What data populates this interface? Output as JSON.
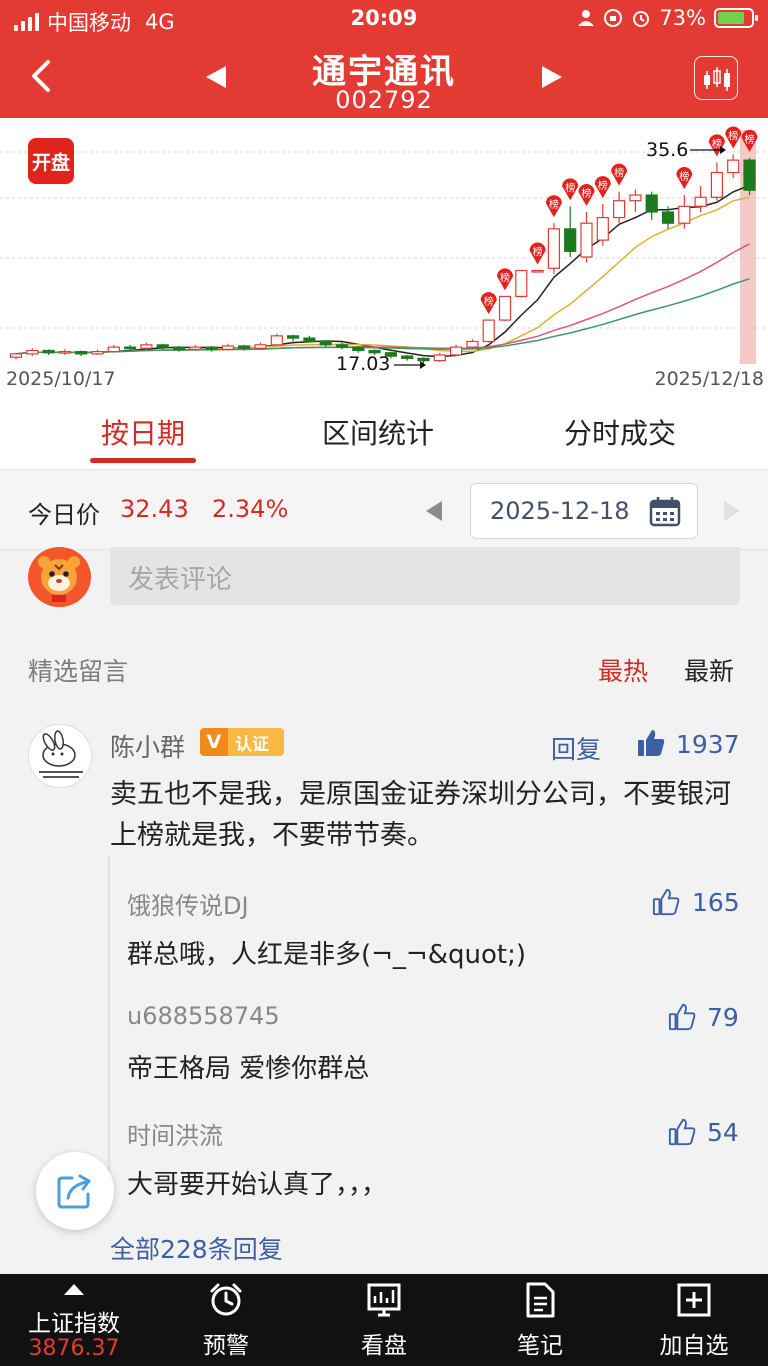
{
  "status_bar": {
    "carrier": "中国移动",
    "network": "4G",
    "time": "20:09",
    "battery": "73%"
  },
  "header": {
    "stock_name": "通宇通讯",
    "stock_code": "002792"
  },
  "chart": {
    "badge": "开盘",
    "start_date": "2025/10/17",
    "end_date": "2025/12/18",
    "high_label": "35.6",
    "low_label": "17.03",
    "list_marker": "榜",
    "colors": {
      "up": "#e33b33",
      "down": "#1d7a1d",
      "ma5": "#222222",
      "ma10": "#e0b030",
      "ma20": "#d9577a",
      "ma30": "#3a9a6a"
    }
  },
  "chart_data": {
    "type": "candlestick",
    "x_start": "2025/10/17",
    "x_end": "2025/12/18",
    "annotations": [
      {
        "label": "35.6",
        "kind": "high"
      },
      {
        "label": "17.03",
        "kind": "low"
      }
    ],
    "candles": [
      [
        17.6,
        17.9,
        17.4,
        18.0
      ],
      [
        17.9,
        18.2,
        17.7,
        18.4
      ],
      [
        18.2,
        18.0,
        17.8,
        18.3
      ],
      [
        18.0,
        18.1,
        17.8,
        18.3
      ],
      [
        18.1,
        17.9,
        17.7,
        18.2
      ],
      [
        17.9,
        18.1,
        17.8,
        18.3
      ],
      [
        18.1,
        18.5,
        18.0,
        18.7
      ],
      [
        18.5,
        18.4,
        18.2,
        18.7
      ],
      [
        18.4,
        18.7,
        18.3,
        18.9
      ],
      [
        18.7,
        18.5,
        18.3,
        18.8
      ],
      [
        18.5,
        18.3,
        18.1,
        18.6
      ],
      [
        18.3,
        18.5,
        18.2,
        18.7
      ],
      [
        18.5,
        18.3,
        18.1,
        18.6
      ],
      [
        18.3,
        18.6,
        18.2,
        18.8
      ],
      [
        18.6,
        18.4,
        18.2,
        18.7
      ],
      [
        18.4,
        18.7,
        18.3,
        18.9
      ],
      [
        18.7,
        19.5,
        18.6,
        19.7
      ],
      [
        19.5,
        19.3,
        19.0,
        19.6
      ],
      [
        19.3,
        19.0,
        18.9,
        19.5
      ],
      [
        19.0,
        18.7,
        18.5,
        19.1
      ],
      [
        18.7,
        18.5,
        18.3,
        18.9
      ],
      [
        18.5,
        18.2,
        18.0,
        18.6
      ],
      [
        18.2,
        18.0,
        17.8,
        18.3
      ],
      [
        18.0,
        17.7,
        17.5,
        18.1
      ],
      [
        17.7,
        17.5,
        17.3,
        17.8
      ],
      [
        17.5,
        17.3,
        17.03,
        17.6
      ],
      [
        17.3,
        17.8,
        17.2,
        18.0
      ],
      [
        17.8,
        18.5,
        17.7,
        18.7
      ],
      [
        18.5,
        19.0,
        18.3,
        19.2
      ],
      [
        19.0,
        20.9,
        18.9,
        20.9
      ],
      [
        20.9,
        23.0,
        20.8,
        23.0
      ],
      [
        23.0,
        25.3,
        22.9,
        25.3
      ],
      [
        25.3,
        25.3,
        25.3,
        25.3
      ],
      [
        25.5,
        29.0,
        25.0,
        29.5
      ],
      [
        29.0,
        27.0,
        26.5,
        31.0
      ],
      [
        26.5,
        29.5,
        26.0,
        30.5
      ],
      [
        28.0,
        30.0,
        27.5,
        31.2
      ],
      [
        30.0,
        31.5,
        29.5,
        32.3
      ],
      [
        31.5,
        32.0,
        30.5,
        32.5
      ],
      [
        32.0,
        30.5,
        29.8,
        32.3
      ],
      [
        30.5,
        29.5,
        29.0,
        31.0
      ],
      [
        29.5,
        31.0,
        29.0,
        32.0
      ],
      [
        31.0,
        31.8,
        30.5,
        32.8
      ],
      [
        31.8,
        34.0,
        31.5,
        34.9
      ],
      [
        34.0,
        35.1,
        33.5,
        35.6
      ],
      [
        35.1,
        32.43,
        32.0,
        35.3
      ]
    ]
  },
  "tabs": [
    {
      "label": "按日期",
      "active": true
    },
    {
      "label": "区间统计",
      "active": false
    },
    {
      "label": "分时成交",
      "active": false
    }
  ],
  "price_row": {
    "label": "今日价",
    "price": "32.43",
    "change": "2.34%",
    "date": "2025-12-18"
  },
  "comment_box": {
    "placeholder": "发表评论"
  },
  "comments_header": {
    "title": "精选留言",
    "sort_hot": "最热",
    "sort_new": "最新"
  },
  "top_comment": {
    "user": "陈小群",
    "badge_v": "V",
    "badge_text": "认证",
    "reply_label": "回复",
    "likes": "1937",
    "text": "卖五也不是我，是原国金证券深圳分公司，不要银河上榜就是我，不要带节奏。",
    "replies": [
      {
        "user": "饿狼传说DJ",
        "text": "群总哦，人红是非多(¬_¬&quot;)",
        "likes": "165"
      },
      {
        "user": "u688558745",
        "text": "帝王格局 爱惨你群总",
        "likes": "79"
      },
      {
        "user": "时间洪流",
        "text": "大哥要开始认真了，，，",
        "likes": "54"
      }
    ],
    "all_replies": "全部228条回复"
  },
  "bottom_nav": {
    "index_name": "上证指数",
    "index_value": "3876.37",
    "items": [
      "预警",
      "看盘",
      "笔记",
      "加自选"
    ]
  }
}
